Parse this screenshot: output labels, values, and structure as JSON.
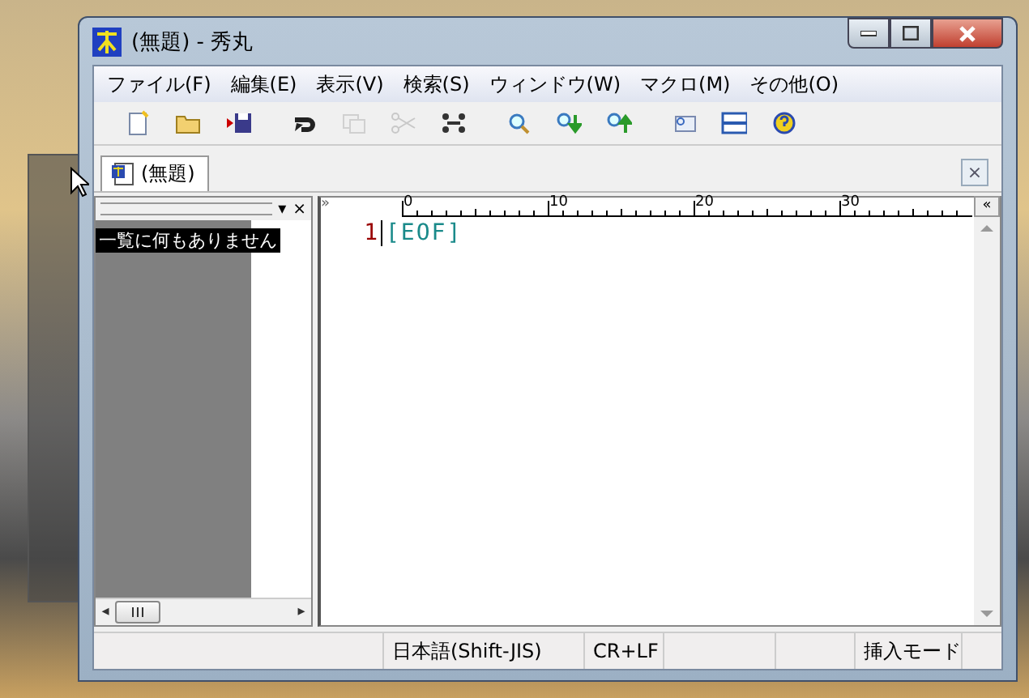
{
  "window": {
    "title": "(無題) - 秀丸"
  },
  "menu": [
    {
      "label": "ファイル(F)"
    },
    {
      "label": "編集(E)"
    },
    {
      "label": "表示(V)"
    },
    {
      "label": "検索(S)"
    },
    {
      "label": "ウィンドウ(W)"
    },
    {
      "label": "マクロ(M)"
    },
    {
      "label": "その他(O)"
    }
  ],
  "toolbar": [
    {
      "kind": "new",
      "disabled": false
    },
    {
      "kind": "open",
      "disabled": false
    },
    {
      "kind": "save",
      "disabled": false
    },
    {
      "kind": "undo",
      "disabled": false
    },
    {
      "kind": "copy",
      "disabled": true
    },
    {
      "kind": "cut",
      "disabled": true
    },
    {
      "kind": "paste",
      "disabled": false
    },
    {
      "kind": "search",
      "disabled": false
    },
    {
      "kind": "search-down",
      "disabled": false
    },
    {
      "kind": "search-up",
      "disabled": false
    },
    {
      "kind": "tag",
      "disabled": false
    },
    {
      "kind": "split",
      "disabled": false
    },
    {
      "kind": "help",
      "disabled": false
    }
  ],
  "tabs": [
    {
      "label": "(無題)",
      "selected": true
    }
  ],
  "tab_close": "×",
  "outline": {
    "dropdown": "▾",
    "close": "×",
    "message": "一覧に何もありません",
    "scroll_left": "◂",
    "scroll_right": "▸"
  },
  "ruler": {
    "left_marker": "»",
    "labels": [
      "0",
      "10",
      "20",
      "30"
    ],
    "collapse": "«"
  },
  "editor": {
    "lines": [
      {
        "number": "1",
        "text": "[EOF]"
      }
    ]
  },
  "status_bar": {
    "encoding": "日本語(Shift-JIS)",
    "line_ending": "CR+LF",
    "mode": "挿入モード"
  }
}
